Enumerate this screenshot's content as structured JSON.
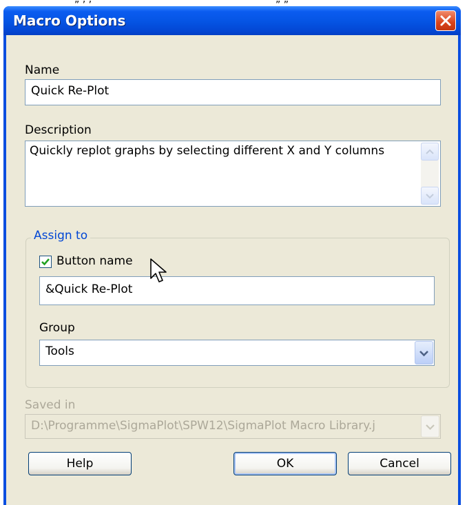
{
  "top_strip": {
    "fragment_left": "„ ‚   ‚",
    "fragment_right": "„         „"
  },
  "window": {
    "title": "Macro Options"
  },
  "name": {
    "label": "Name",
    "value": "Quick Re-Plot"
  },
  "description": {
    "label": "Description",
    "value": "Quickly replot graphs by selecting different X and Y columns"
  },
  "assign_to": {
    "legend": "Assign to",
    "button_name_checkbox_label": "Button name",
    "button_name_checked": true,
    "button_name_value": "&Quick Re-Plot",
    "group_label": "Group",
    "group_value": "Tools"
  },
  "saved_in": {
    "label": "Saved in",
    "value": "D:\\Programme\\SigmaPlot\\SPW12\\SigmaPlot Macro Library.j"
  },
  "buttons": {
    "help": "Help",
    "ok": "OK",
    "cancel": "Cancel"
  },
  "colors": {
    "title_bar": "#0554e3",
    "face": "#ece9d8",
    "group_legend": "#0046d5",
    "close_button": "#d9431b"
  }
}
